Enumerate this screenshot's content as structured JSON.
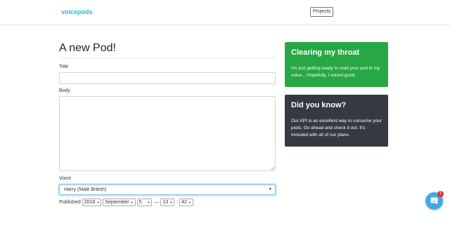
{
  "navbar": {
    "brand": "voicepods",
    "projects_button": "Projects"
  },
  "form": {
    "heading": "A new Pod!",
    "title_label": "Title",
    "title_value": "",
    "body_label": "Body",
    "body_value": "",
    "voice_label": "Voice",
    "voice_selected": "Harry (Male British)",
    "published_label": "Published",
    "published": {
      "year": "2018",
      "month": "September",
      "day": "5",
      "dash": "—",
      "hour": "13",
      "colon": ":",
      "minute": "42"
    }
  },
  "cards": [
    {
      "title": "Clearing my throat",
      "text": "I'm just getting ready to read your pod in my voice... Hopefully, I sound good.",
      "color": "#28a745"
    },
    {
      "title": "Did you know?",
      "text": "Our API is an excellent way to consume your pods. Go ahead and check it out. It's included with all of our plans.",
      "color": "#343a40"
    }
  ],
  "chat": {
    "badge_count": "1",
    "icon": "chat-icon"
  },
  "colors": {
    "brand": "#2bb5e0",
    "chat": "#3fa9e6",
    "badge": "#e0352b"
  }
}
